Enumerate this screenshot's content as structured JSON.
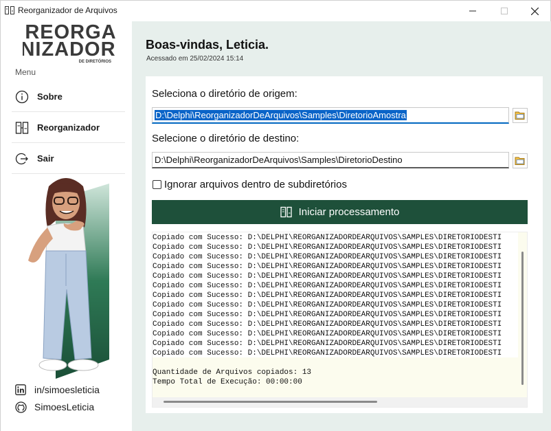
{
  "window": {
    "title": "Reorganizador de Arquivos"
  },
  "sidebar": {
    "logo_line1": "REORGA",
    "logo_line2": "NIZADOR",
    "logo_sub": "DE DIRETÓRIOS",
    "menu_caption": "Menu",
    "items": [
      {
        "label": "Sobre",
        "icon": "info-icon"
      },
      {
        "label": "Reorganizador",
        "icon": "reorganize-icon"
      },
      {
        "label": "Sair",
        "icon": "exit-icon"
      }
    ],
    "links": [
      {
        "label": "in/simoesleticia",
        "icon": "linkedin-icon"
      },
      {
        "label": "SimoesLeticia",
        "icon": "github-icon"
      }
    ]
  },
  "main": {
    "welcome": "Boas-vindas, Leticia.",
    "access": "Acessado em 25/02/2024 15:14",
    "origin_label": "Seleciona o diretório de origem:",
    "origin_value": "D:\\Delphi\\ReorganizadorDeArquivos\\Samples\\DiretorioAmostra",
    "dest_label": "Selecione o diretório de destino:",
    "dest_value": "D:\\Delphi\\ReorganizadorDeArquivos\\Samples\\DiretorioDestino",
    "checkbox_label": "Ignorar arquivos dentro de subdiretórios",
    "checkbox_checked": false,
    "start_button": "Iniciar processamento",
    "log": {
      "copied_line": "Copiado com Sucesso: D:\\DELPHI\\REORGANIZADORDEARQUIVOS\\SAMPLES\\DIRETORIODESTI",
      "copied_count": 13,
      "summary_count": "Quantidade de Arquivos copiados: 13",
      "summary_time": "Tempo Total de Execução: 00:00:00"
    }
  },
  "colors": {
    "accent_green": "#1e503a",
    "main_bg": "#e7efec",
    "log_bg": "#fcfcee",
    "selection": "#0a64c8"
  }
}
